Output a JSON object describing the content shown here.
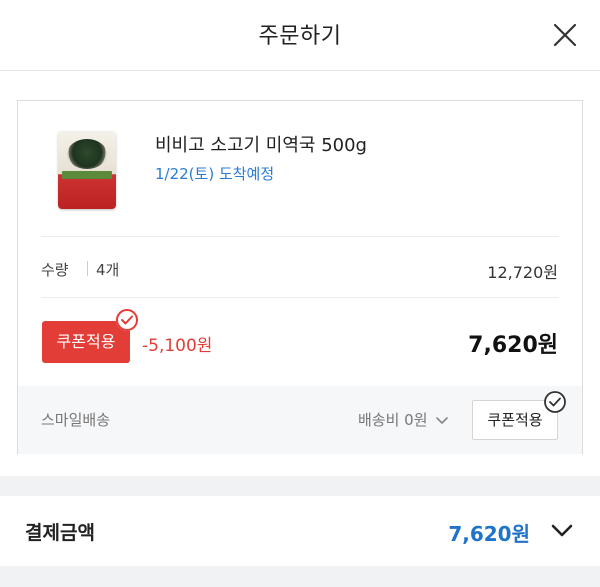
{
  "header": {
    "title": "주문하기",
    "close_icon": "close-icon"
  },
  "product": {
    "name": "비비고 소고기 미역국 500g",
    "arrival": "1/22(토) 도착예정",
    "thumbnail_icon": "product-thumbnail"
  },
  "quantity": {
    "label": "수량",
    "value": "4개",
    "subtotal": "12,720원"
  },
  "coupon": {
    "button_label": "쿠폰적용",
    "discount": "-5,100원",
    "final_price": "7,620원",
    "applied": true
  },
  "shipping": {
    "method": "스마일배송",
    "fee_label": "배송비 0원",
    "coupon_button_label": "쿠폰적용"
  },
  "total": {
    "label": "결제금액",
    "amount": "7,620원"
  },
  "colors": {
    "accent_red": "#e23d36",
    "accent_blue": "#2a7bd4",
    "total_blue": "#1f73c9"
  }
}
